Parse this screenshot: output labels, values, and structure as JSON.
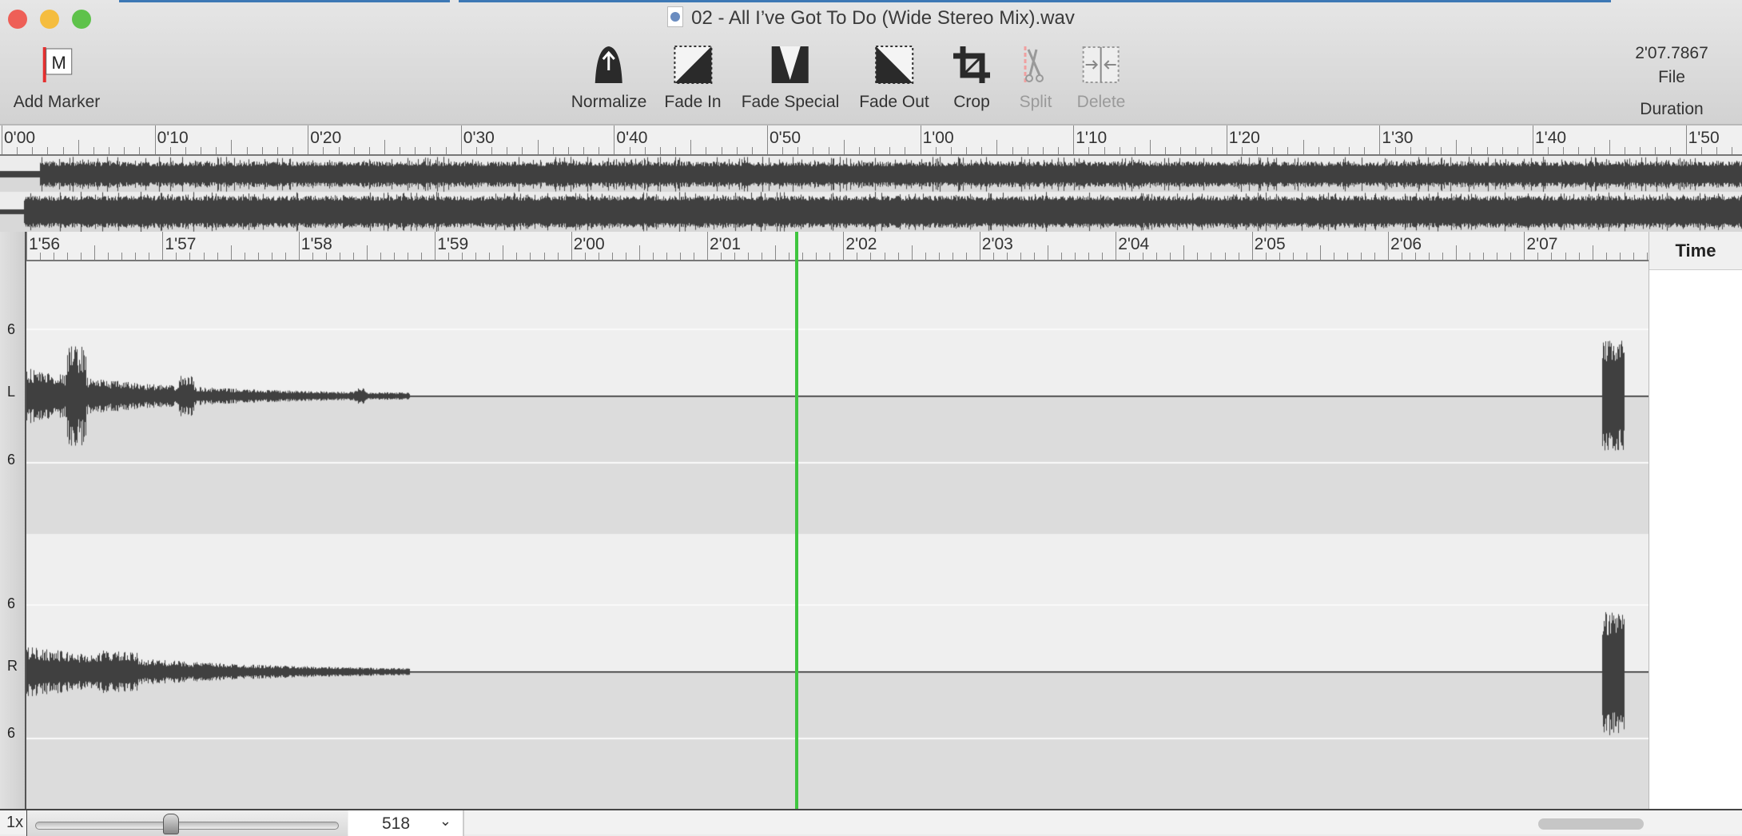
{
  "window": {
    "title": "02 - All I’ve Got To Do (Wide Stereo Mix).wav"
  },
  "toolbar": {
    "add_marker": "Add Marker",
    "normalize": "Normalize",
    "fade_in": "Fade In",
    "fade_special": "Fade Special",
    "fade_out": "Fade Out",
    "crop": "Crop",
    "split": "Split",
    "delete": "Delete"
  },
  "duration": {
    "value": "2'07.7867",
    "mode": "File",
    "label": "Duration"
  },
  "overview_ruler": {
    "labels": [
      "0'00",
      "0'10",
      "0'20",
      "0'30",
      "0'40",
      "0'50",
      "1'00",
      "1'10",
      "1'20",
      "1'30",
      "1'40",
      "1'50"
    ]
  },
  "detail_ruler": {
    "labels": [
      "1'56",
      "1'57",
      "1'58",
      "1'59",
      "2'00",
      "2'01",
      "2'02",
      "2'03",
      "2'04",
      "2'05",
      "2'06",
      "2'07"
    ]
  },
  "channels": {
    "left": {
      "label": "L",
      "scale_top": "6",
      "scale_bottom": "6"
    },
    "right": {
      "label": "R",
      "scale_top": "6",
      "scale_bottom": "6"
    }
  },
  "side_panel": {
    "header": "Time"
  },
  "bottom": {
    "zoom_label": "1x",
    "zoom_value": "518",
    "zoom_slider_fraction": 0.42
  },
  "colors": {
    "playhead": "#3fc53f",
    "waveform": "#404040",
    "marker_flag": "#e53030"
  }
}
